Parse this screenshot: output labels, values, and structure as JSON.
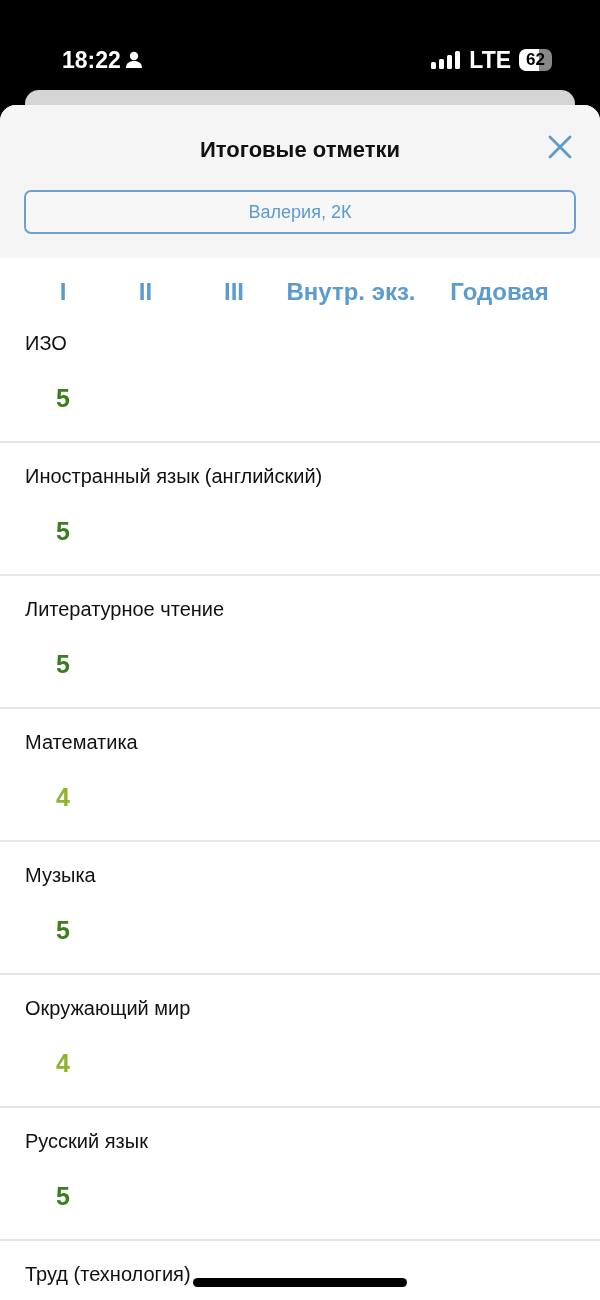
{
  "status_bar": {
    "time": "18:22",
    "network": "LTE",
    "battery": "62"
  },
  "sheet": {
    "title": "Итоговые отметки",
    "student": "Валерия, 2К"
  },
  "columns": [
    "I",
    "II",
    "III",
    "Внутр. экз.",
    "Годовая"
  ],
  "subjects": [
    {
      "name": "ИЗО",
      "grade": "5",
      "color": "#3b7d1e"
    },
    {
      "name": "Иностранный язык (английский)",
      "grade": "5",
      "color": "#3b7d1e"
    },
    {
      "name": "Литературное чтение",
      "grade": "5",
      "color": "#3b7d1e"
    },
    {
      "name": "Математика",
      "grade": "4",
      "color": "#8db42c"
    },
    {
      "name": "Музыка",
      "grade": "5",
      "color": "#3b7d1e"
    },
    {
      "name": "Окружающий мир",
      "grade": "4",
      "color": "#8db42c"
    },
    {
      "name": "Русский язык",
      "grade": "5",
      "color": "#3b7d1e"
    },
    {
      "name": "Труд (технология)"
    }
  ]
}
